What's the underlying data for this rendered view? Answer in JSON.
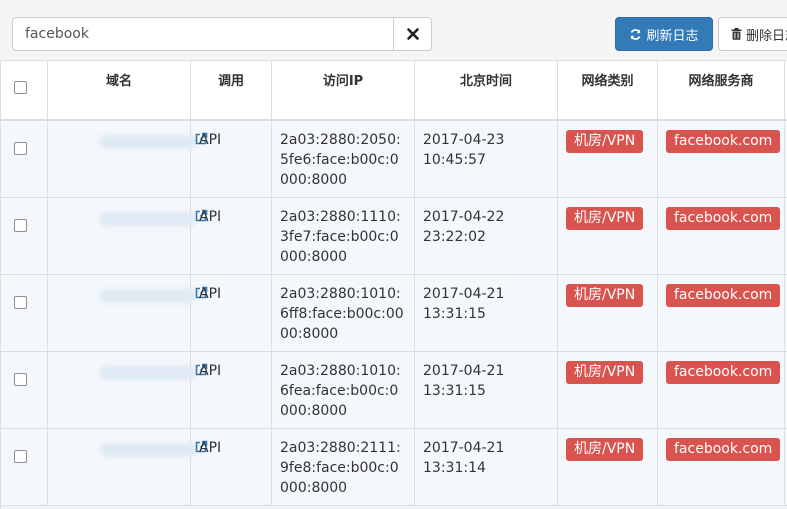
{
  "toolbar": {
    "search_value": "facebook",
    "refresh_label": "刷新日志",
    "delete_label": "删除日志"
  },
  "icons": {
    "clear": "close-icon",
    "refresh": "refresh-icon",
    "delete": "trash-icon",
    "external": "external-link-icon"
  },
  "colors": {
    "primary": "#337ab7",
    "danger": "#d9534f",
    "link": "#337ab7"
  },
  "table": {
    "headers": [
      "域名",
      "调用",
      "访问IP",
      "北京时间",
      "网络类别",
      "网络服务商"
    ],
    "rows": [
      {
        "call": "API",
        "ip": "2a03:2880:2050:5fe6:face:b00c:0000:8000",
        "time": "2017-04-23 10:45:57",
        "category": "机房/VPN",
        "provider": "facebook.com"
      },
      {
        "call": "API",
        "ip": "2a03:2880:1110:3fe7:face:b00c:0000:8000",
        "time": "2017-04-22 23:22:02",
        "category": "机房/VPN",
        "provider": "facebook.com"
      },
      {
        "call": "API",
        "ip": "2a03:2880:1010:6ff8:face:b00c:0000:8000",
        "time": "2017-04-21 13:31:15",
        "category": "机房/VPN",
        "provider": "facebook.com"
      },
      {
        "call": "API",
        "ip": "2a03:2880:1010:6fea:face:b00c:0000:8000",
        "time": "2017-04-21 13:31:15",
        "category": "机房/VPN",
        "provider": "facebook.com"
      },
      {
        "call": "API",
        "ip": "2a03:2880:2111:9fe8:face:b00c:0000:8000",
        "time": "2017-04-21 13:31:14",
        "category": "机房/VPN",
        "provider": "facebook.com"
      }
    ]
  }
}
